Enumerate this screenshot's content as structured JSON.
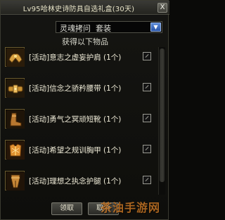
{
  "window": {
    "title": "Lv95哈林史诗防具自选礼盒(30天)",
    "close_label": "X"
  },
  "selector": {
    "value": "灵魂拷问  套装",
    "arrow": "▼"
  },
  "subtitle": "获得以下物品",
  "items": [
    {
      "label": "[活动]意志之虚妄护肩 (1个)",
      "icon": "shoulder-armor-icon",
      "color": "#d8a040"
    },
    {
      "label": "[活动]信念之骄矜腰带 (1个)",
      "icon": "belt-armor-icon",
      "color": "#c89030"
    },
    {
      "label": "[活动]勇气之冥顽短靴 (1个)",
      "icon": "boots-armor-icon",
      "color": "#b87830"
    },
    {
      "label": "[活动]希望之规训胸甲 (1个)",
      "icon": "chest-armor-icon",
      "color": "#e09030"
    },
    {
      "label": "[活动]理想之执念护腿 (1个)",
      "icon": "leg-armor-icon",
      "color": "#c88838"
    }
  ],
  "buttons": {
    "confirm": "领取",
    "cancel": "取消"
  },
  "watermark": "茶油手游网"
}
